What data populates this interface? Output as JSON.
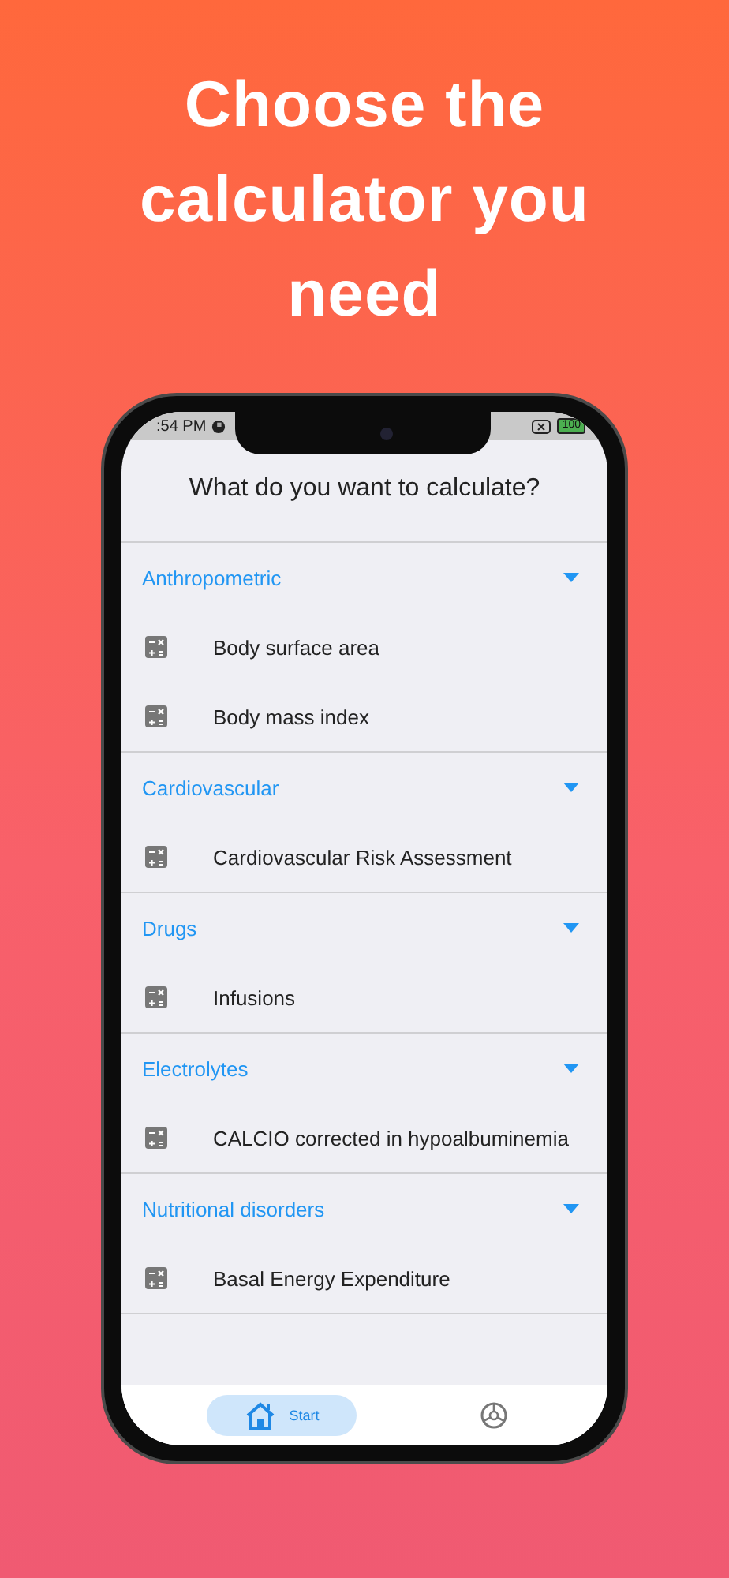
{
  "heading": "Choose the calculator you need",
  "status_bar": {
    "time": ":54 PM",
    "battery": "100"
  },
  "title": "What do you want to calculate?",
  "sections": [
    {
      "label": "Anthropometric",
      "expanded": true,
      "items": [
        {
          "label": "Body surface area"
        },
        {
          "label": "Body mass index"
        }
      ]
    },
    {
      "label": "Cardiovascular",
      "expanded": true,
      "items": [
        {
          "label": "Cardiovascular Risk Assessment"
        }
      ]
    },
    {
      "label": "Drugs",
      "expanded": true,
      "items": [
        {
          "label": "Infusions"
        }
      ]
    },
    {
      "label": "Electrolytes",
      "expanded": true,
      "items": [
        {
          "label": "CALCIO corrected in hypoalbuminemia"
        }
      ]
    },
    {
      "label": "Nutritional disorders",
      "expanded": true,
      "items": [
        {
          "label": "Basal Energy Expenditure"
        }
      ]
    }
  ],
  "nav": [
    {
      "kind": "home",
      "label": "Start",
      "selected": true
    },
    {
      "kind": "settings",
      "selected": false
    }
  ]
}
